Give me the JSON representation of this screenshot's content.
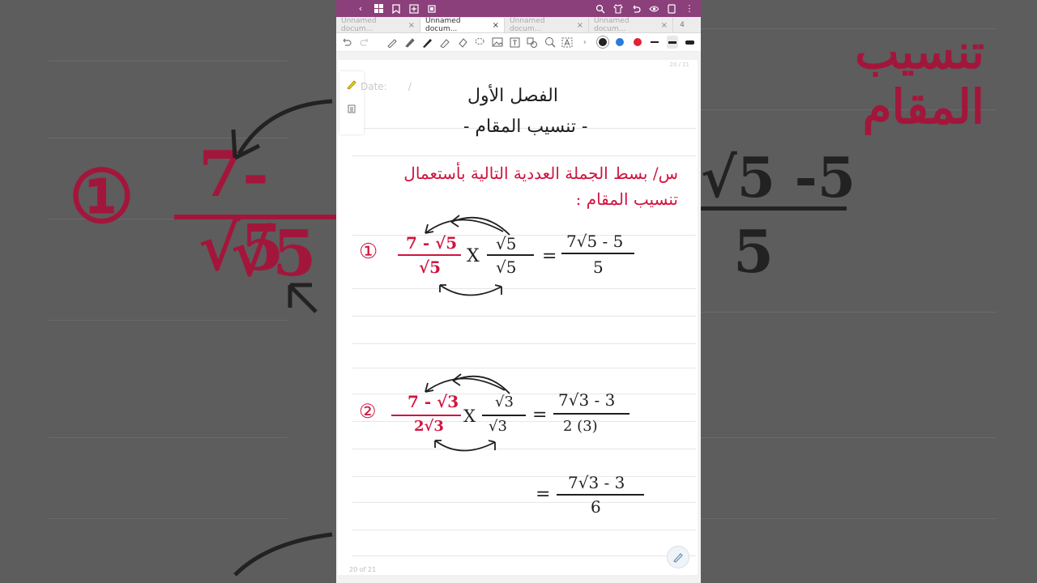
{
  "tabs": [
    {
      "label": "Unnamed docum...",
      "active": false
    },
    {
      "label": "Unnamed docum...",
      "active": true
    },
    {
      "label": "Unnamed docum...",
      "active": false
    },
    {
      "label": "Unnamed docum...",
      "active": false
    }
  ],
  "tab_count": "4",
  "tab_close": "×",
  "colors": {
    "status_bar": "#8b3f7b",
    "ink_red": "#d0143f",
    "ink_black": "#1f1f1f",
    "blue": "#2b7bdb"
  },
  "icons": {
    "back": "chevron-left-icon",
    "grid": "grid-icon",
    "bookmark": "bookmark-icon",
    "add_page": "add-page-icon",
    "crop": "crop-icon",
    "search": "search-icon",
    "shirt": "theme-icon",
    "undo": "undo-icon",
    "eye": "eye-icon",
    "more": "more-icon"
  },
  "page": {
    "date_label": "Date:",
    "date_sep": "/",
    "nav": "20 / 21",
    "footer": "20 of 21",
    "title": "الفصل الأول",
    "subtitle": "- تنسيب المقام -",
    "question": "س/ بسط الجملة العددية التالية بأستعمال",
    "question2": "تنسيب المقام :",
    "p1_num": "①",
    "p1_expr_num": "7 - √5",
    "p1_expr_den": "√5",
    "p1_mult_num": "√5",
    "p1_mult_den": "√5",
    "p1_res_num": "7√5 - 5",
    "p1_res_den": "5",
    "p2_num": "②",
    "p2_expr_num": "7 - √3",
    "p2_expr_den": "2√3",
    "p2_mult_num": "√3",
    "p2_mult_den": "√3",
    "p2_res_num": "7√3 - 3",
    "p2_res_den": "2 (3)",
    "p3_res_num": "7√3 - 3",
    "p3_res_den": "6",
    "times": "X",
    "eq": "="
  },
  "bg": {
    "left_circle": "①",
    "left_num": "7-√5",
    "left_den": "√5",
    "right_top": "تنسيب المقام",
    "right_num": "√5 -5",
    "right_den": "5"
  }
}
